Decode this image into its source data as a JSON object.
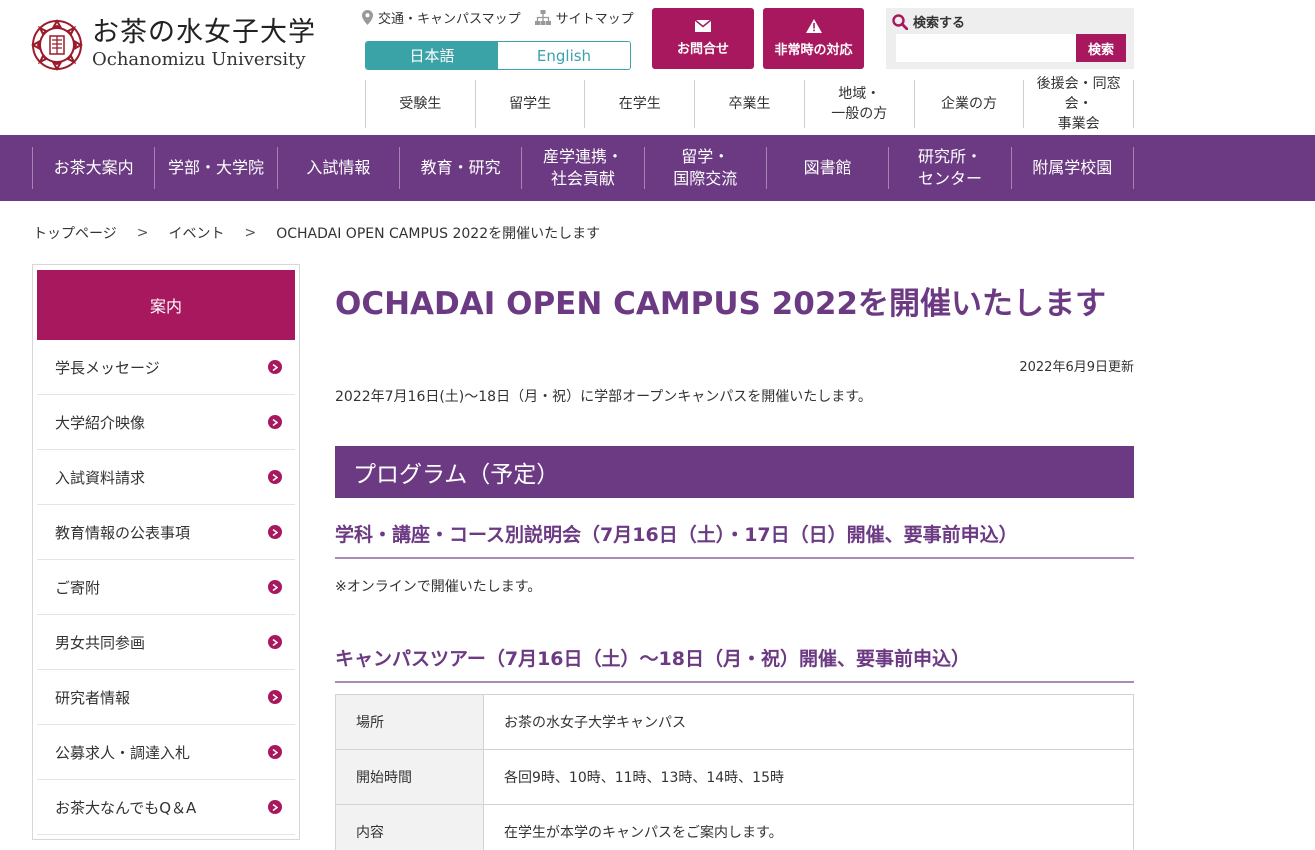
{
  "header": {
    "logo": {
      "jp": "お茶の水女子大学",
      "en": "Ochanomizu University"
    },
    "util_links": [
      {
        "label": "交通・キャンパスマップ",
        "icon": "map-pin-icon"
      },
      {
        "label": "サイトマップ",
        "icon": "sitemap-icon"
      }
    ],
    "lang": {
      "ja": "日本語",
      "en": "English"
    },
    "contact_label": "お問合せ",
    "emergency_label": "非常時の対応",
    "search": {
      "title": "検索する",
      "button": "検索",
      "placeholder": ""
    },
    "audience_nav": [
      "受験生",
      "留学生",
      "在学生",
      "卒業生",
      "地域・\n一般の方",
      "企業の方",
      "後援会・同窓会・\n事業会"
    ]
  },
  "global_nav": [
    "お茶大案内",
    "学部・大学院",
    "入試情報",
    "教育・研究",
    "産学連携・\n社会貢献",
    "留学・\n国際交流",
    "図書館",
    "研究所・\nセンター",
    "附属学校園"
  ],
  "breadcrumb": [
    "トップページ",
    "イベント",
    "OCHADAI OPEN CAMPUS 2022を開催いたします"
  ],
  "sidebar": {
    "heading": "案内",
    "items": [
      "学長メッセージ",
      "大学紹介映像",
      "入試資料請求",
      "教育情報の公表事項",
      "ご寄附",
      "男女共同参画",
      "研究者情報",
      "公募求人・調達入札",
      "お茶大なんでもQ＆A"
    ]
  },
  "main": {
    "title": "OCHADAI OPEN CAMPUS 2022を開催いたします",
    "updated": "2022年6月9日更新",
    "intro": "2022年7月16日(土)～18日（月・祝）に学部オープンキャンパスを開催いたします。",
    "section_title": "プログラム（予定）",
    "sub1": "学科・講座・コース別説明会（7月16日（土）・17日（日）開催、要事前申込）",
    "note": "※オンラインで開催いたします。",
    "sub2": "キャンパスツアー（7月16日（土）～18日（月・祝）開催、要事前申込）",
    "table": [
      {
        "label": "場所",
        "value": "お茶の水女子大学キャンパス"
      },
      {
        "label": "開始時間",
        "value": "各回9時、10時、11時、13時、14時、15時"
      },
      {
        "label": "内容",
        "value": "在学生が本学のキャンパスをご案内します。"
      }
    ]
  },
  "colors": {
    "brand_purple": "#6c3a83",
    "accent_magenta": "#a8185e",
    "teal": "#3aa3a8"
  }
}
